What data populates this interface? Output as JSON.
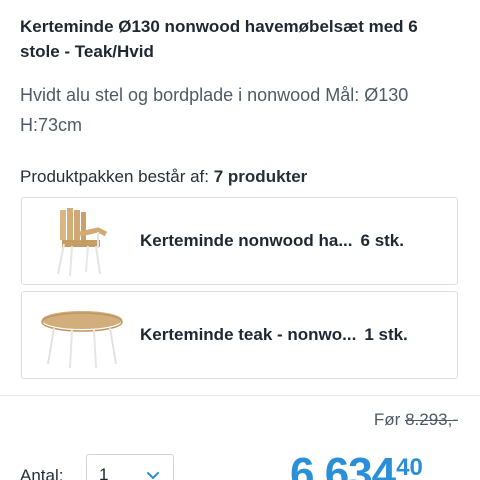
{
  "product": {
    "title": "Kerteminde Ø130 nonwood havemøbelsæt med 6 stole - Teak/Hvid",
    "description": "Hvidt alu stel og bordplade i nonwood Mål: Ø130 H:73cm"
  },
  "bundle": {
    "heading_prefix": "Produktpakken består af:",
    "heading_count": "7 produkter",
    "items": [
      {
        "name": "Kerteminde nonwood ha...",
        "qty": "6 stk.",
        "icon": "garden-chair-icon"
      },
      {
        "name": "Kerteminde teak - nonwo...",
        "qty": "1 stk.",
        "icon": "round-table-icon"
      }
    ]
  },
  "pricing": {
    "old_label": "Før",
    "old_value": "8.293,-",
    "current_main": "6.634",
    "current_decimals": "40"
  },
  "quantity": {
    "label": "Antal:",
    "value": "1",
    "options": [
      "1"
    ]
  },
  "colors": {
    "price": "#2a8fd6",
    "text": "#1e2832",
    "muted": "#4e5b66",
    "border": "#dcdfe2"
  }
}
